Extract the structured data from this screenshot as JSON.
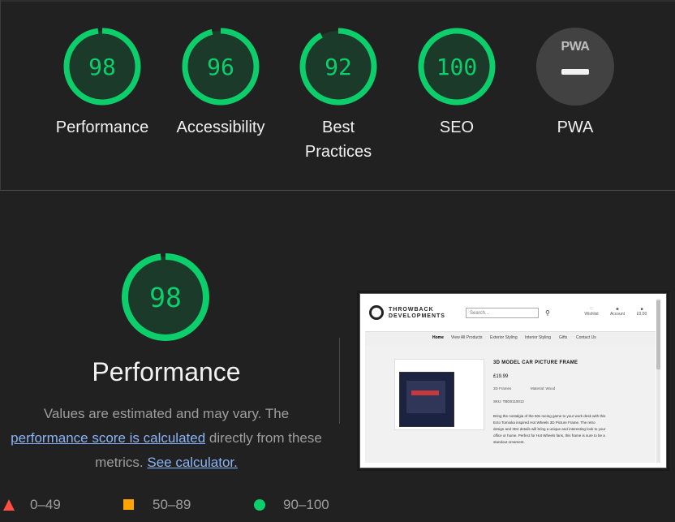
{
  "categories": [
    {
      "label": "Performance",
      "score": "98",
      "value": 98
    },
    {
      "label": "Accessibility",
      "score": "96",
      "value": 96
    },
    {
      "label": "Best Practices",
      "score": "92",
      "value": 92
    },
    {
      "label": "SEO",
      "score": "100",
      "value": 100
    }
  ],
  "pwa": {
    "badge_text": "PWA",
    "label": "PWA"
  },
  "performance": {
    "score": "98",
    "value": 98,
    "title": "Performance",
    "desc_before": "Values are estimated and may vary. The",
    "desc_link": "performance score is calculated",
    "desc_after": "directly from these metrics.",
    "calc_link": "See calculator."
  },
  "legend": {
    "fail": "0–49",
    "average": "50–89",
    "pass": "90–100"
  },
  "colors": {
    "pass": "#0cce6b",
    "average": "#ffa400",
    "fail": "#ff4e42",
    "link": "#8ab4f8"
  },
  "screenshot": {
    "brand_line1": "THROWBACK",
    "brand_line2": "DEVELOPMENTS",
    "search_placeholder": "Search...",
    "wishlist": "Wishlist",
    "account": "Account",
    "cart": "£0.00",
    "nav": [
      "Home",
      "View All Products",
      "Exterior Styling",
      "Interior Styling",
      "Gifts",
      "Contact Us"
    ],
    "product_title": "3D MODEL CAR PICTURE FRAME",
    "price": "£19.99",
    "category": "3D Frames",
    "material": "Material: Wood",
    "sku": "SKU: TBD0110012",
    "description": "Bring the nostalgia of the 50s racing game to your work desk with this Ecto Tomioka inspired Hot Wheels 3D Picture Frame. The retro design and 3D4 details will bring a unique and interesting look to your office or home. Perfect for Hot Wheels fans, this frame is sure to be a standout ornament."
  }
}
